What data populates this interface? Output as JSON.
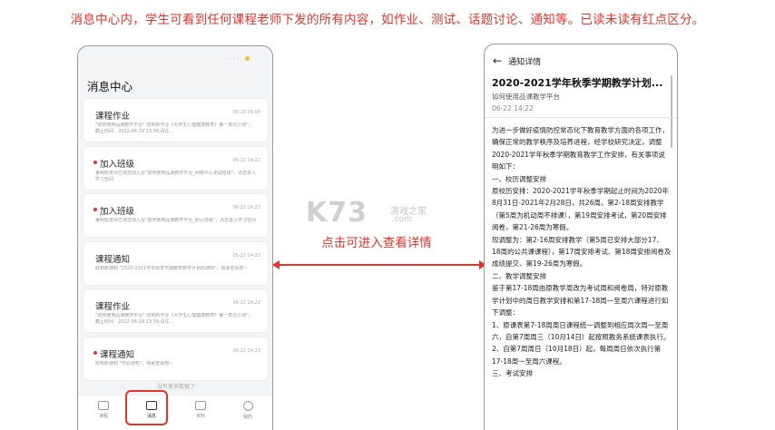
{
  "banner": "消息中心内，学生可看到任何课程老师下发的所有内容，如作业、测试、话题讨论、通知等。已读未读有红点区分。",
  "left_phone": {
    "status_text": "· · ·",
    "title": "消息中心",
    "messages": [
      {
        "title": "课程作业",
        "time": "06-28 09:00",
        "desc": "\"如何使用品课教学平台\" 收到新作业《大学生心理健康教育》第一单元小测”，截止时间：2022-06-29 13:59,请在...",
        "unread": false
      },
      {
        "title": "加入班级",
        "time": "06-22 14:22",
        "desc": "董明班老师已将您加入至\"如何使用品课教学平台_网络中心测试班级\"，点击进入学习空间",
        "unread": true
      },
      {
        "title": "加入班级",
        "time": "06-22 14:22",
        "desc": "董明班老师已将您加入至\"如何使用品课教学平台_默认班级\"，点击进入学习空间",
        "unread": true
      },
      {
        "title": "课程通知",
        "time": "06-22 14:22",
        "desc": "收到新通知 \"2020-2021学年秋季学期教育教学计划的通知\"，快来查看吧~",
        "unread": false
      },
      {
        "title": "课程作业",
        "time": "06-22 14:22",
        "desc": "\"如何使用品课教学平台\" 收到新作业《大学生心理健康教育》第一单元小测”，截止时间：2022-06-29 13:59,请在...",
        "unread": false
      },
      {
        "title": "课程通知",
        "time": "06-22 14:22",
        "desc": "收到新通知 \"作业通知\"，快来查看吧~",
        "unread": true
      }
    ],
    "no_more": "没有更多数据了",
    "tabs": [
      {
        "label": "课程",
        "icon": "course-icon"
      },
      {
        "label": "消息",
        "icon": "message-icon"
      },
      {
        "label": "资料",
        "icon": "document-icon"
      },
      {
        "label": "我的",
        "icon": "profile-icon"
      }
    ],
    "active_tab": "消息"
  },
  "middle": {
    "label": "点击可进入查看详情",
    "watermark": "K73",
    "watermark_sub1": "游戏之家",
    "watermark_sub2": ".com"
  },
  "right_phone": {
    "nav_title": "通知详情",
    "title": "2020-2021学年秋季学期教学计划...",
    "source": "如何使用品课教学平台",
    "date": "06-22 14:22",
    "body": [
      "为进一步做好疫情防控常态化下教育教学方面的各项工作，确保正常的教学秩序及培养进程，经学校研究决定，调整2020-2021学年秋季学期教育教学工作安排，有关事项说明如下：",
      "一、校历调整安排",
      "原校历安排：2020-2021学年秋季学期起止时间为2020年8月31日-2021年2月28日，共26周。第2-18周安排教学（第5周为机动周不排课），第19周安排考试，第20周安排阅卷，第21-26周为寒假。",
      "现调整为：第2-16周安排教学（第5周已安排大部分17、18周的公共课课程），第17周安排考试、第18周安排阅卷及成绩提交、第19-26周为寒假。",
      "二、教学调整安排",
      "鉴于第17-18周由原教学周改为考试周和阅卷周，特对原教学计划中的周日教学安排和第17-18周一至周六课程进行如下调整：",
      "1、原课表第7-18周周日课程统一调整到相应周次周一至周六，自第7周周三（10月14日）起按照教务系统课表执行。",
      "2、自第7周周日（10月18日）起，每周周日依次执行第17-18周一至周六课程。",
      "三、考试安排"
    ]
  },
  "colors": {
    "accent": "#e8332a",
    "unread_dot": "#ee3333"
  }
}
